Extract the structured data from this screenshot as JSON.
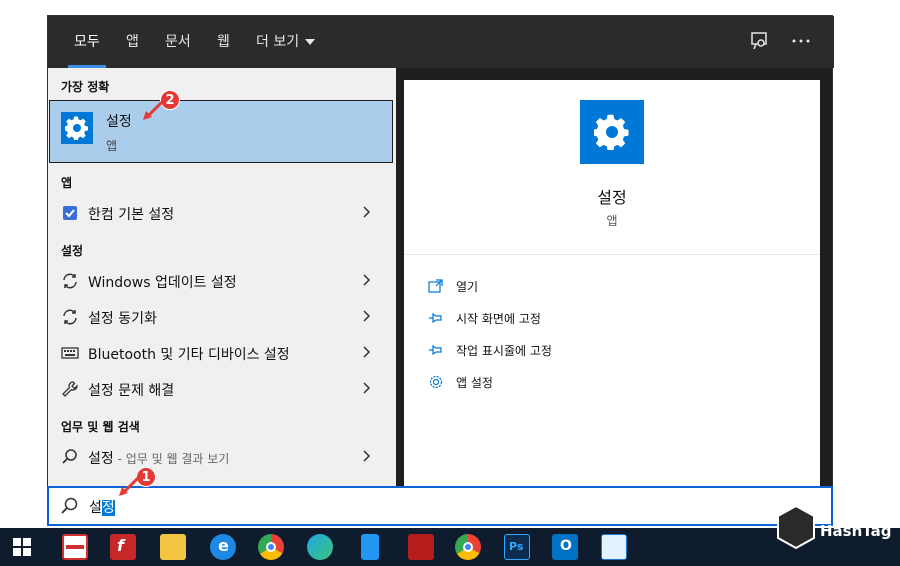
{
  "topnav": {
    "tabs": [
      "모두",
      "앱",
      "문서",
      "웹",
      "더 보기"
    ]
  },
  "best_match": {
    "header": "가장 정확",
    "title": "설정",
    "subtitle": "앱"
  },
  "apps": {
    "header": "앱",
    "items": [
      {
        "label": "한컴 기본 설정",
        "icon": "hancom-settings-icon"
      }
    ]
  },
  "settings": {
    "header": "설정",
    "items": [
      {
        "label": "Windows 업데이트 설정",
        "icon": "sync-icon"
      },
      {
        "label": "설정 동기화",
        "icon": "sync-icon"
      },
      {
        "label": "Bluetooth 및 기타 디바이스 설정",
        "icon": "keyboard-icon"
      },
      {
        "label": "설정 문제 해결",
        "icon": "wrench-icon"
      }
    ]
  },
  "web": {
    "header": "업무 및 웹 검색",
    "item_term": "설정",
    "item_suffix": " - 업무 및 웹 결과 보기"
  },
  "preview": {
    "title": "설정",
    "subtitle": "앱",
    "actions": [
      {
        "label": "열기",
        "icon": "open-icon"
      },
      {
        "label": "시작 화면에 고정",
        "icon": "pin-icon"
      },
      {
        "label": "작업 표시줄에 고정",
        "icon": "pin-icon"
      },
      {
        "label": "앱 설정",
        "icon": "gear-icon"
      }
    ]
  },
  "search": {
    "text_prefix": "설",
    "text_selected": "정"
  },
  "badges": {
    "first": "1",
    "second": "2"
  },
  "watermark": {
    "text": "HashTag"
  },
  "colors": {
    "accent": "#0078d7",
    "selection": "#a9cdea",
    "nav_bg": "#2b2b2b",
    "taskbar": "#0f1c2e"
  }
}
